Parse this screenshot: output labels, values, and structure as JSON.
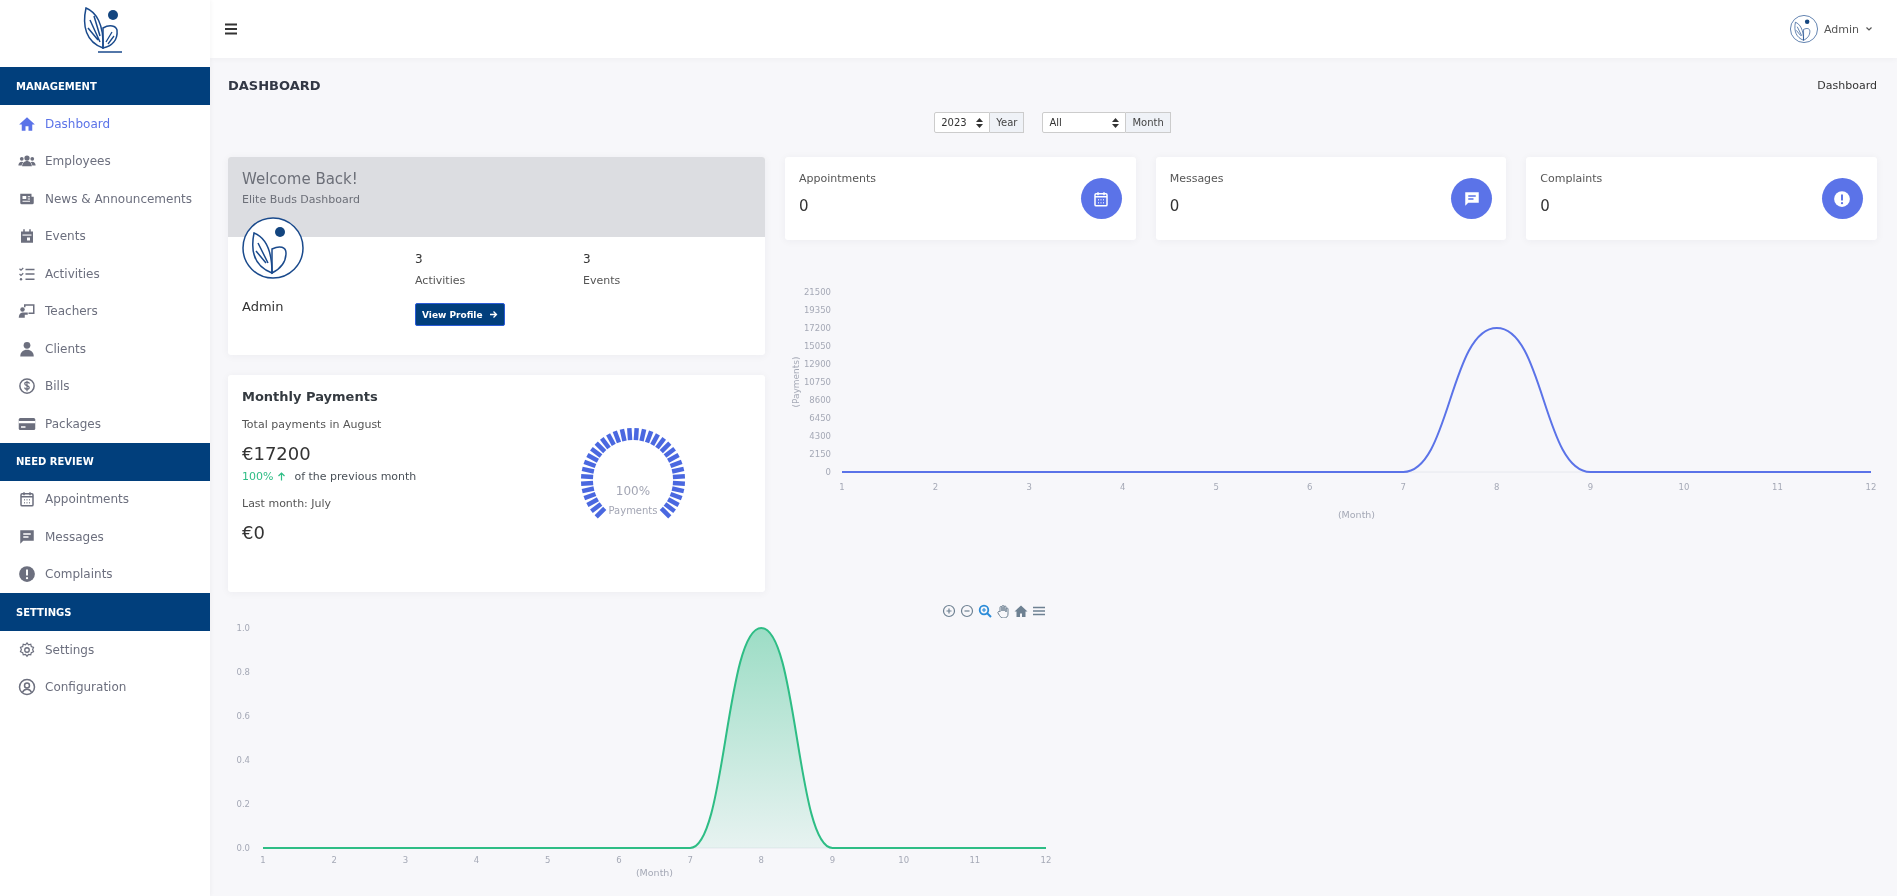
{
  "header": {
    "user": "Admin"
  },
  "sidebar": {
    "sections": [
      {
        "title": "MANAGEMENT",
        "items": [
          {
            "label": "Dashboard",
            "selected": true
          },
          {
            "label": "Employees",
            "selected": false
          },
          {
            "label": "News & Announcements",
            "selected": false
          },
          {
            "label": "Events",
            "selected": false
          },
          {
            "label": "Activities",
            "selected": false
          },
          {
            "label": "Teachers",
            "selected": false
          },
          {
            "label": "Clients",
            "selected": false
          },
          {
            "label": "Bills",
            "selected": false
          },
          {
            "label": "Packages",
            "selected": false
          }
        ]
      },
      {
        "title": "NEED REVIEW",
        "items": [
          {
            "label": "Appointments",
            "selected": false
          },
          {
            "label": "Messages",
            "selected": false
          },
          {
            "label": "Complaints",
            "selected": false
          }
        ]
      },
      {
        "title": "SETTINGS",
        "items": [
          {
            "label": "Settings",
            "selected": false
          },
          {
            "label": "Configuration",
            "selected": false
          }
        ]
      }
    ]
  },
  "page": {
    "title": "DASHBOARD",
    "breadcrumb": "Dashboard"
  },
  "filters": [
    {
      "value": "2023",
      "suffix": "Year"
    },
    {
      "value": "All",
      "suffix": "Month"
    }
  ],
  "welcome": {
    "title": "Welcome Back!",
    "subtitle": "Elite Buds Dashboard",
    "name": "Admin",
    "stats": [
      {
        "value": "3",
        "label": "Activities"
      },
      {
        "value": "3",
        "label": "Events"
      }
    ],
    "button": "View Profile"
  },
  "stat_cards": [
    {
      "label": "Appointments",
      "value": "0"
    },
    {
      "label": "Messages",
      "value": "0"
    },
    {
      "label": "Complaints",
      "value": "0"
    }
  ],
  "payments_chart": {
    "chart_data": {
      "type": "line",
      "xlabel": "(Month)",
      "ylabel": "(Payments)",
      "categories": [
        "1",
        "2",
        "3",
        "4",
        "5",
        "6",
        "7",
        "8",
        "9",
        "10",
        "11",
        "12"
      ],
      "series": [
        {
          "color": "#5b73e8",
          "values": [
            0,
            0,
            0,
            0,
            0,
            0,
            0,
            17200,
            0,
            0,
            0,
            0
          ]
        }
      ],
      "ylim": [
        0,
        21500
      ],
      "yticks": [
        0,
        2150,
        4300,
        6450,
        8600,
        10750,
        12900,
        15050,
        17200,
        19350,
        21500
      ]
    }
  },
  "monthly_payments": {
    "title": "Monthly Payments",
    "period": "Total payments in August",
    "amount": "€17200",
    "change": "100%",
    "change_text": "of the previous month",
    "last_month": "Last month: July",
    "last_amount": "€0",
    "gauge": {
      "level": 1,
      "reading": "100%",
      "label": "Payments"
    }
  },
  "trend_chart": {
    "toolbar": [
      {
        "selected": false
      },
      {
        "selected": false
      },
      {
        "selected": true
      },
      {
        "selected": false
      },
      {
        "selected": false
      },
      {
        "selected": false
      }
    ],
    "chart_data": {
      "type": "area",
      "xlabel": "(Month)",
      "categories": [
        "1",
        "2",
        "3",
        "4",
        "5",
        "6",
        "7",
        "8",
        "9",
        "10",
        "11",
        "12"
      ],
      "series": [
        {
          "color": "#2ebd85",
          "values": [
            0,
            0,
            0,
            0,
            0,
            0,
            0,
            1,
            0,
            0,
            0,
            0
          ]
        }
      ],
      "ylim": [
        0,
        1
      ],
      "yticks": [
        {
          "value": 0,
          "label": "0.0"
        },
        {
          "value": 0.2,
          "label": "0.2"
        },
        {
          "value": 0.4,
          "label": "0.4"
        },
        {
          "value": 0.6,
          "label": "0.6"
        },
        {
          "value": 0.8,
          "label": "0.8"
        },
        {
          "value": 1,
          "label": "1.0"
        }
      ]
    }
  }
}
